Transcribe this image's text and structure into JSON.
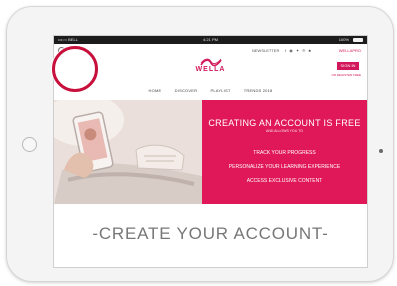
{
  "statusbar": {
    "carrier": "•••○○ BELL ",
    "time": "4:21 PM",
    "battery": "100%"
  },
  "topbar": {
    "newsletter": "NEWSLETTER",
    "social_icons": "f ◉ ✦ ℗ ♣",
    "account_link": "WELLAPRO"
  },
  "logo": {
    "text": "WELLA"
  },
  "auth": {
    "signin": "SIGN IN",
    "register": "OR REGISTER FREE"
  },
  "nav": {
    "items": [
      "HOME",
      "DISCOVER",
      "PLAYLIST",
      "TRENDS 2018"
    ]
  },
  "hero": {
    "title": "CREATING AN ACCOUNT IS FREE",
    "subtitle": "AND ALLOWS YOU TO",
    "benefits": [
      "TRACK YOUR PROGRESS",
      "PERSONALIZE YOUR LEARNING EXPERIENCE",
      "ACCESS EXCLUSIVE CONTENT"
    ]
  },
  "main": {
    "create_title": "-CREATE YOUR ACCOUNT-"
  },
  "colors": {
    "brand": "#d2185a",
    "hero_panel": "#e0185a",
    "highlight": "#c8103c"
  }
}
